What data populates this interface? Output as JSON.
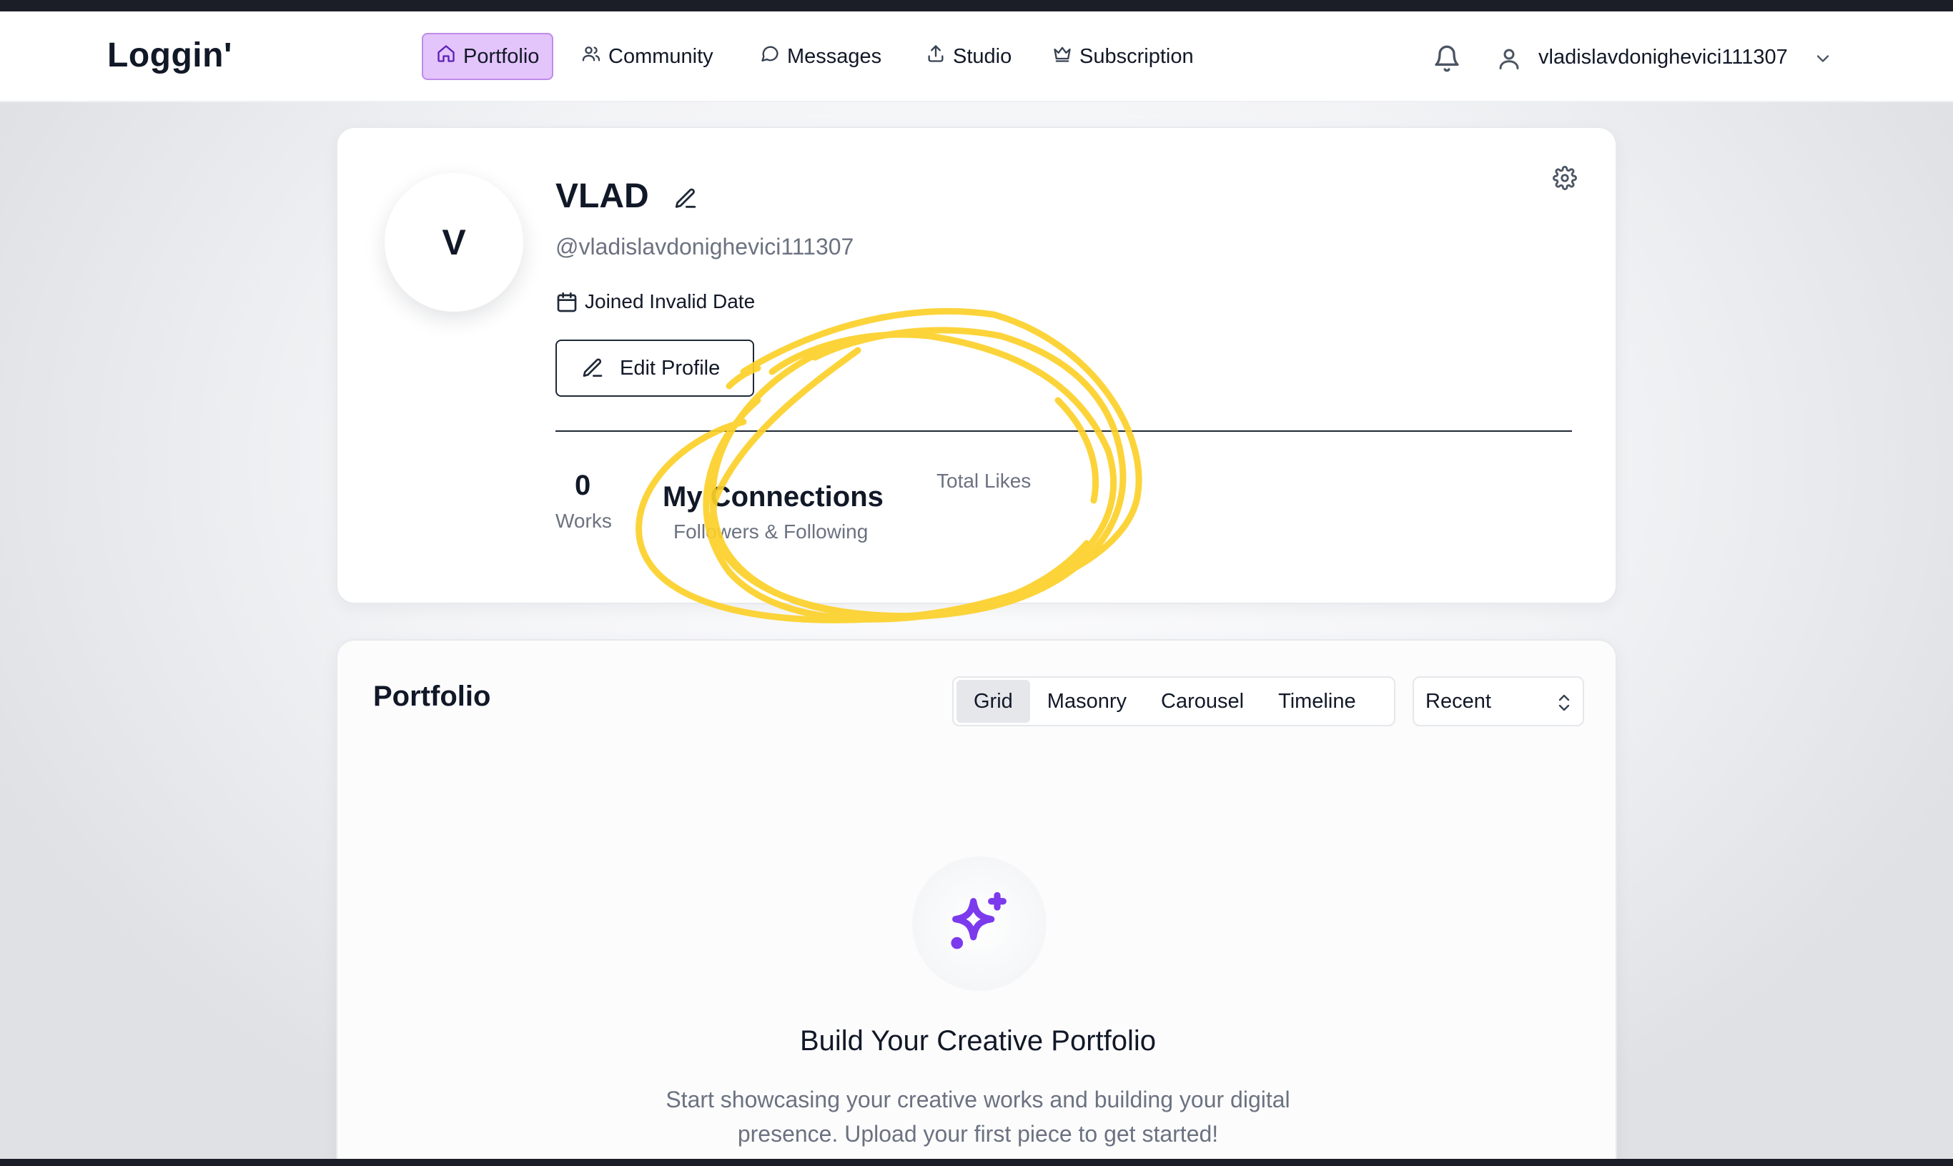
{
  "app": {
    "logo": "Loggin'"
  },
  "nav": {
    "items": [
      {
        "label": "Portfolio",
        "icon": "home-icon",
        "active": true
      },
      {
        "label": "Community",
        "icon": "users-icon",
        "active": false
      },
      {
        "label": "Messages",
        "icon": "message-icon",
        "active": false
      },
      {
        "label": "Studio",
        "icon": "upload-icon",
        "active": false
      },
      {
        "label": "Subscription",
        "icon": "crown-icon",
        "active": false
      }
    ],
    "username": "vladislavdonighevici111307"
  },
  "profile": {
    "avatar_initial": "V",
    "display_name": "VLAD",
    "handle": "@vladislavdonighevici111307",
    "joined": "Joined Invalid Date",
    "edit_button": "Edit Profile",
    "stats": {
      "works_value": "0",
      "works_label": "Works",
      "connections_title": "My Connections",
      "connections_label": "Followers & Following",
      "likes_label": "Total Likes"
    }
  },
  "portfolio": {
    "title": "Portfolio",
    "views": [
      "Grid",
      "Masonry",
      "Carousel",
      "Timeline"
    ],
    "active_view": "Grid",
    "sort_value": "Recent",
    "empty_title": "Build Your Creative Portfolio",
    "empty_description": "Start showcasing your creative works and building your digital presence. Upload your first piece to get started!"
  },
  "colors": {
    "accent": "#7c3aed",
    "nav_active_bg": "#e3c4fb",
    "annotation": "#fcd12a"
  }
}
